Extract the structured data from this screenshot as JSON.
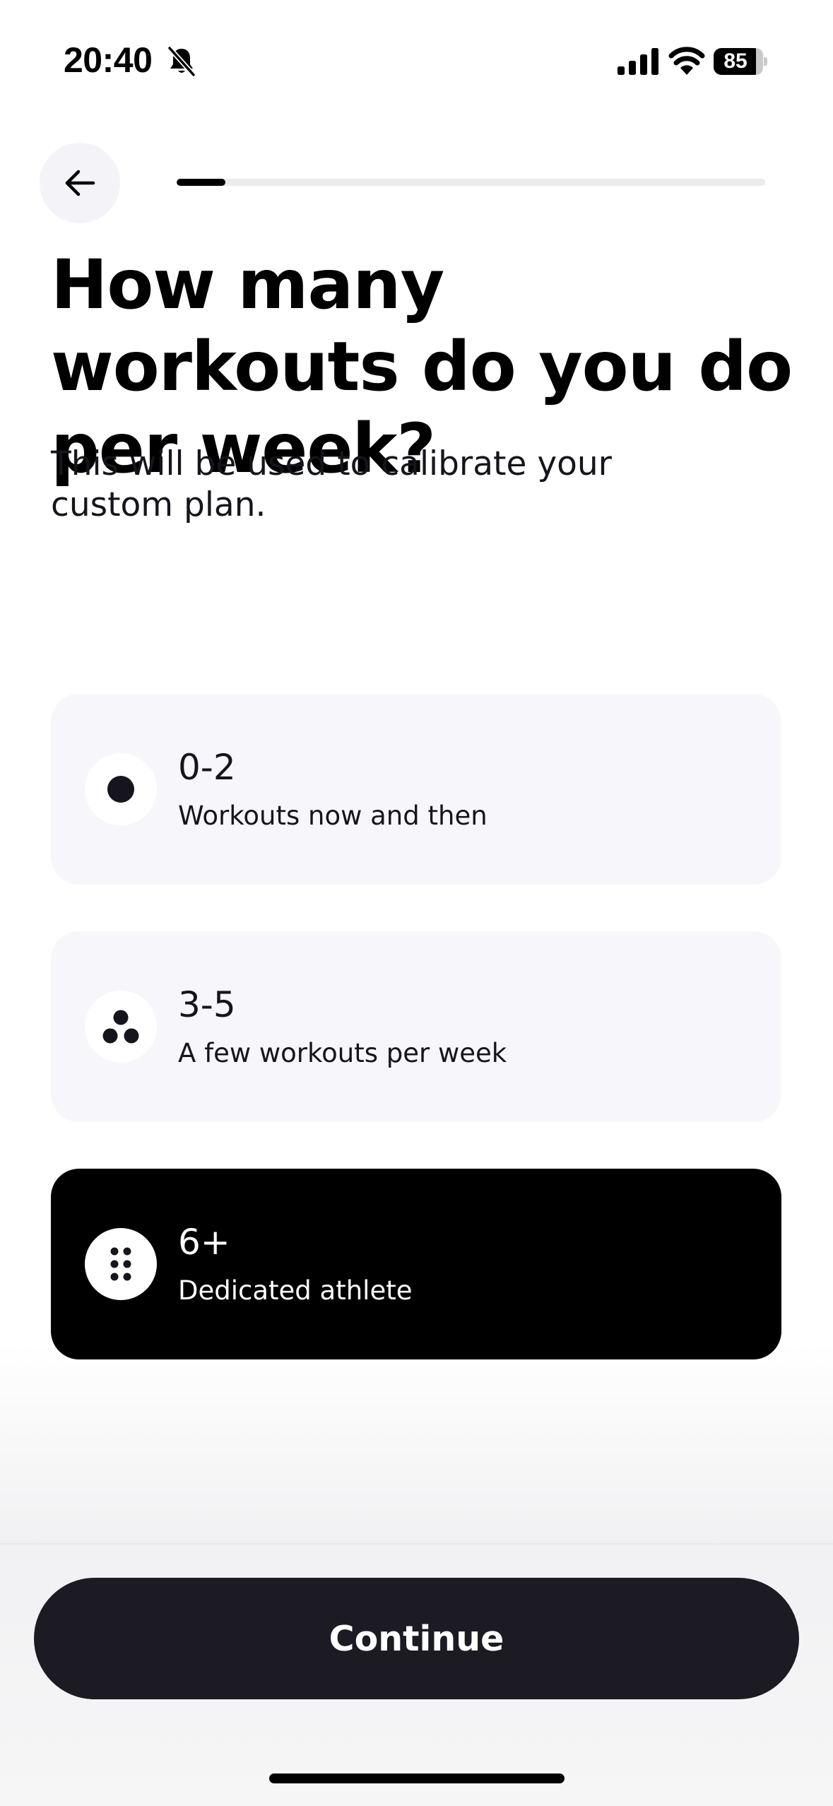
{
  "status_bar": {
    "time": "20:40",
    "battery_level": "85",
    "icons": [
      "bell-slash-icon",
      "cellular-signal-icon",
      "wifi-icon",
      "battery-icon"
    ]
  },
  "header": {
    "back_icon": "arrow-left-icon",
    "progress_fraction": 0.083
  },
  "question": {
    "title": "How many workouts do you do per week?",
    "subtitle": "This will be used to calibrate your custom plan."
  },
  "options": [
    {
      "value": "0-2",
      "description": "Workouts now and then",
      "icon": "single-dot-icon",
      "selected": false
    },
    {
      "value": "3-5",
      "description": "A few workouts per week",
      "icon": "three-dots-icon",
      "selected": false
    },
    {
      "value": "6+",
      "description": "Dedicated athlete",
      "icon": "six-dots-icon",
      "selected": true
    }
  ],
  "footer": {
    "continue_label": "Continue"
  },
  "colors": {
    "primary_dark": "#1c1a22",
    "option_background": "#f7f7fb",
    "selected_background": "#000000",
    "progress_track": "#ececef"
  }
}
